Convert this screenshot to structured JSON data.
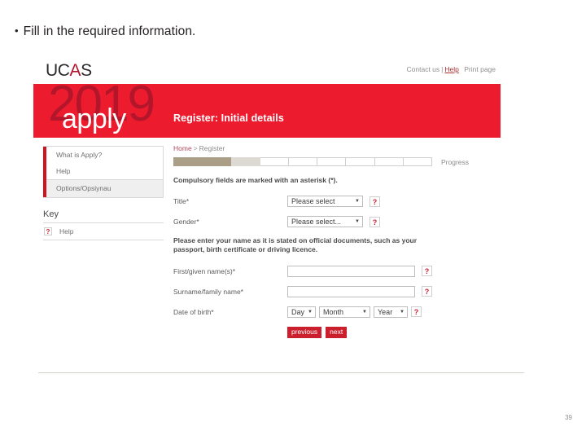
{
  "slide": {
    "bullet_text": "Fill in the required information.",
    "bullet_glyph": "•",
    "page_number": "39"
  },
  "header": {
    "logo_uc": "UC",
    "logo_a": "A",
    "logo_s": "S",
    "utility_links": {
      "contact": "Contact us",
      "separator": "|",
      "help": "Help",
      "print": "Print page"
    }
  },
  "banner": {
    "year": "2019",
    "apply": "apply",
    "title": "Register: Initial details",
    "background_color": "#ec1c2e",
    "year_color": "#b3152a"
  },
  "sidebar": {
    "nav_items": [
      {
        "label": "What is Apply?",
        "active": false
      },
      {
        "label": "Help",
        "active": false
      },
      {
        "label": "Options/Opsiynau",
        "active": true
      }
    ],
    "key_heading": "Key",
    "key_entries": [
      {
        "icon": "question-mark",
        "label": "Help"
      }
    ],
    "accent_color": "#d1131f"
  },
  "main": {
    "breadcrumb": {
      "home": "Home",
      "separator": ">",
      "current": "Register"
    },
    "progress": {
      "label": "Progress",
      "segments": [
        "done",
        "done",
        "half",
        "empty",
        "empty",
        "empty",
        "empty",
        "empty",
        "empty"
      ],
      "done_color": "#ab9e87",
      "half_color": "#ddd9d3"
    },
    "compulsory_note": "Compulsory fields are marked with an asterisk (*).",
    "name_note": "Please enter your name as it is stated on official documents, such as your passport, birth certificate or driving licence.",
    "fields": {
      "title": {
        "label": "Title*",
        "value": "Please select",
        "help_icon": "?"
      },
      "gender": {
        "label": "Gender*",
        "value": "Please select...",
        "help_icon": "?"
      },
      "first_name": {
        "label": "First/given name(s)*",
        "value": "",
        "help_icon": "?"
      },
      "surname": {
        "label": "Surname/family name*",
        "value": "",
        "help_icon": "?"
      },
      "date_of_birth": {
        "label": "Date of birth*",
        "day": "Day",
        "month": "Month",
        "year": "Year",
        "help_icon": "?"
      }
    },
    "buttons": {
      "previous": "previous",
      "next": "next",
      "color": "#cc1f2d"
    },
    "caret_glyph": "▼"
  }
}
